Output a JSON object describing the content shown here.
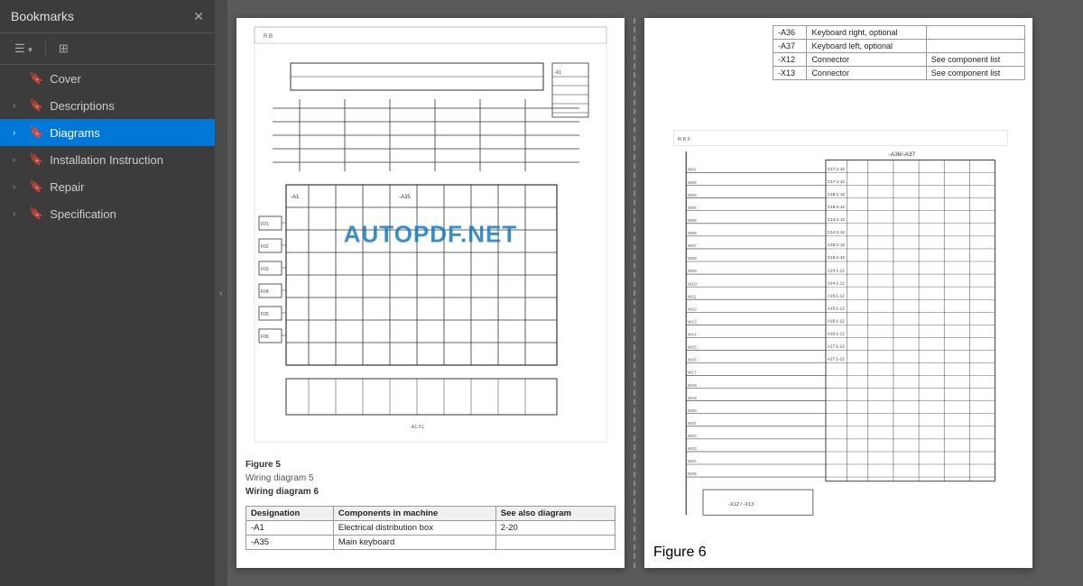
{
  "sidebar": {
    "title": "Bookmarks",
    "close_label": "✕",
    "toolbar": {
      "expand_btn": "☰▾",
      "bookmark_btn": "🔖"
    },
    "items": [
      {
        "id": "cover",
        "label": "Cover",
        "level": 0,
        "active": false,
        "expandable": false
      },
      {
        "id": "descriptions",
        "label": "Descriptions",
        "level": 0,
        "active": false,
        "expandable": true
      },
      {
        "id": "diagrams",
        "label": "Diagrams",
        "level": 0,
        "active": true,
        "expandable": true
      },
      {
        "id": "installation",
        "label": "Installation Instruction",
        "level": 0,
        "active": false,
        "expandable": true
      },
      {
        "id": "repair",
        "label": "Repair",
        "level": 0,
        "active": false,
        "expandable": true
      },
      {
        "id": "specification",
        "label": "Specification",
        "level": 0,
        "active": false,
        "expandable": true
      }
    ]
  },
  "collapse_handle": "‹",
  "page1": {
    "figure_num": "Figure 5",
    "figure_sub": "Wiring diagram 5",
    "figure_bold": "Wiring diagram 6",
    "table_headers": [
      "Designation",
      "Components in machine",
      "See also diagram"
    ],
    "table_rows": [
      {
        "designation": "-A1",
        "component": "Electrical distribution box",
        "diagram": "2-20"
      },
      {
        "designation": "-A35",
        "component": "Main keyboard",
        "diagram": ""
      }
    ]
  },
  "page2": {
    "figure_num": "Figure 6",
    "top_table_rows": [
      {
        "ref": "-A36",
        "component": "Keyboard right, optional",
        "note": ""
      },
      {
        "ref": "-A37",
        "component": "Keyboard left, optional",
        "note": ""
      },
      {
        "ref": "-X12",
        "component": "Connector",
        "note": "See component list"
      },
      {
        "ref": "-X13",
        "component": "Connector",
        "note": "See component list"
      }
    ]
  },
  "watermark": {
    "text": "AUTOPDF.NET"
  },
  "colors": {
    "sidebar_bg": "#3c3c3c",
    "sidebar_active": "#0078d7",
    "watermark": "#1a7cbf",
    "page_bg": "#ffffff"
  }
}
